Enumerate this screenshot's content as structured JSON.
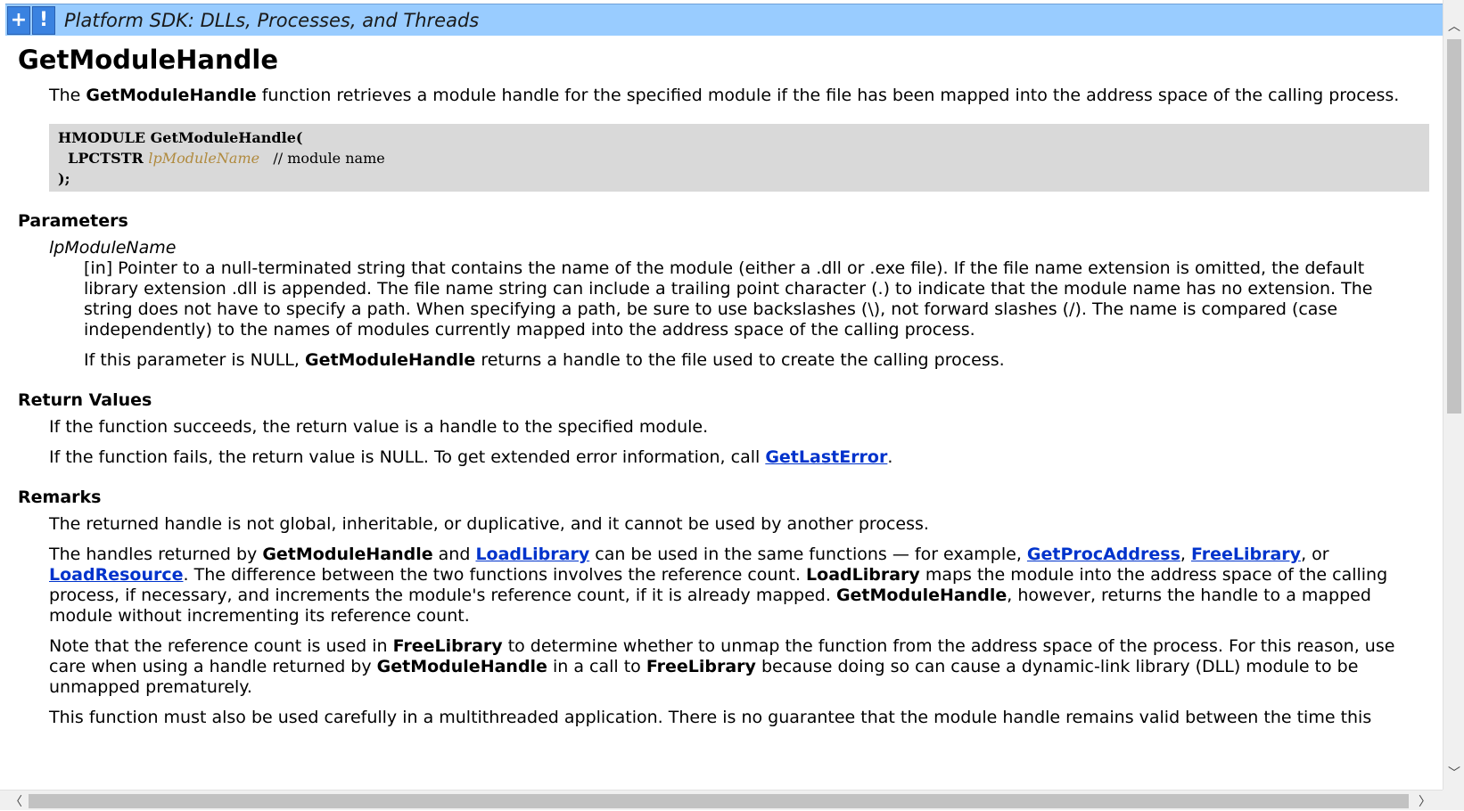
{
  "titlebar": {
    "plus_button": "+",
    "bang_button": "!",
    "title": "Platform SDK: DLLs, Processes, and Threads"
  },
  "page": {
    "heading": "GetModuleHandle",
    "intro_prefix": "The ",
    "intro_bold": "GetModuleHandle",
    "intro_suffix": " function retrieves a module handle for the specified module if the file has been mapped into the address space of the calling process.",
    "syntax": {
      "line1_type": "HMODULE GetModuleHandle(",
      "line2_type": "  LPCTSTR ",
      "line2_param": "lpModuleName",
      "line2_comment": "   // module name",
      "line3": ");"
    },
    "parameters": {
      "heading": "Parameters",
      "name": "lpModuleName",
      "desc": "[in] Pointer to a null-terminated string that contains the name of the module (either a .dll or .exe file). If the file name extension is omitted, the default library extension .dll is appended. The file name string can include a trailing point character (.) to indicate that the module name has no extension. The string does not have to specify a path. When specifying a path, be sure to use backslashes (\\), not forward slashes (/). The name is compared (case independently) to the names of modules currently mapped into the address space of the calling process.",
      "null_prefix": "If this parameter is NULL, ",
      "null_bold": "GetModuleHandle",
      "null_suffix": " returns a handle to the file used to create the calling process."
    },
    "return_values": {
      "heading": "Return Values",
      "success": "If the function succeeds, the return value is a handle to the specified module.",
      "fail_prefix": "If the function fails, the return value is NULL. To get extended error information, call ",
      "fail_link": "GetLastError",
      "fail_suffix": "."
    },
    "remarks": {
      "heading": "Remarks",
      "p1": "The returned handle is not global, inheritable, or duplicative, and it cannot be used by another process.",
      "p2_a": "The handles returned by ",
      "p2_b": "GetModuleHandle",
      "p2_c": " and ",
      "p2_link1": "LoadLibrary",
      "p2_d": " can be used in the same functions — for example, ",
      "p2_link2": "GetProcAddress",
      "p2_e": ", ",
      "p2_link3": "FreeLibrary",
      "p2_f": ", or ",
      "p2_link4": "LoadResource",
      "p2_g": ". The difference between the two functions involves the reference count. ",
      "p2_h": "LoadLibrary",
      "p2_i": " maps the module into the address space of the calling process, if necessary, and increments the module's reference count, if it is already mapped. ",
      "p2_j": "GetModuleHandle",
      "p2_k": ", however, returns the handle to a mapped module without incrementing its reference count.",
      "p3_a": "Note that the reference count is used in ",
      "p3_b": "FreeLibrary",
      "p3_c": " to determine whether to unmap the function from the address space of the process. For this reason, use care when using a handle returned by ",
      "p3_d": "GetModuleHandle",
      "p3_e": " in a call to ",
      "p3_f": "FreeLibrary",
      "p3_g": " because doing so can cause a dynamic-link library (DLL) module to be unmapped prematurely.",
      "p4": "This function must also be used carefully in a multithreaded application. There is no guarantee that the module handle remains valid between the time this"
    }
  },
  "scrollbars": {
    "up_arrow": "︿",
    "down_arrow": "﹀",
    "left_arrow": "〈",
    "right_arrow": "〉"
  },
  "colors": {
    "titlebar_bg": "#99ccff",
    "button_bg": "#3a82e0",
    "code_bg": "#d9d9d9",
    "param_color": "#b08a3e",
    "link_color": "#0033cc"
  }
}
